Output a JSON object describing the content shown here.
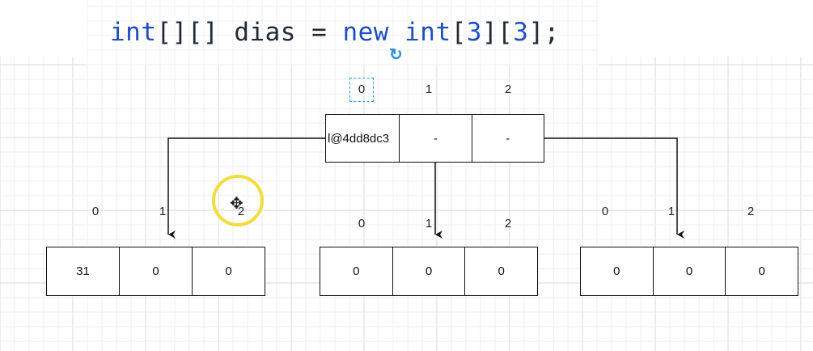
{
  "code": {
    "type1": "int",
    "brackets1": "[][]",
    "name": " dias = ",
    "kw_new": "new",
    "type2": " int",
    "open1": "[",
    "size1": "3",
    "close_open": "][",
    "size2": "3",
    "close_end": "];"
  },
  "outer_array": {
    "indices": [
      "0",
      "1",
      "2"
    ],
    "cells": [
      "l@4dd8dc3",
      "-",
      "-"
    ]
  },
  "inner_arrays": [
    {
      "indices": [
        "0",
        "1",
        "2"
      ],
      "cells": [
        "31",
        "0",
        "0"
      ]
    },
    {
      "indices": [
        "0",
        "1",
        "2"
      ],
      "cells": [
        "0",
        "0",
        "0"
      ]
    },
    {
      "indices": [
        "0",
        "1",
        "2"
      ],
      "cells": [
        "0",
        "0",
        "0"
      ]
    }
  ],
  "icons": {
    "cursor": "move-cursor-icon",
    "refresh": "refresh-icon",
    "move_glyph": "✥",
    "refresh_glyph": "↻"
  },
  "colors": {
    "keyword": "#1f4fbf",
    "highlight": "#f2dc3e",
    "selection": "#2a9de0"
  }
}
